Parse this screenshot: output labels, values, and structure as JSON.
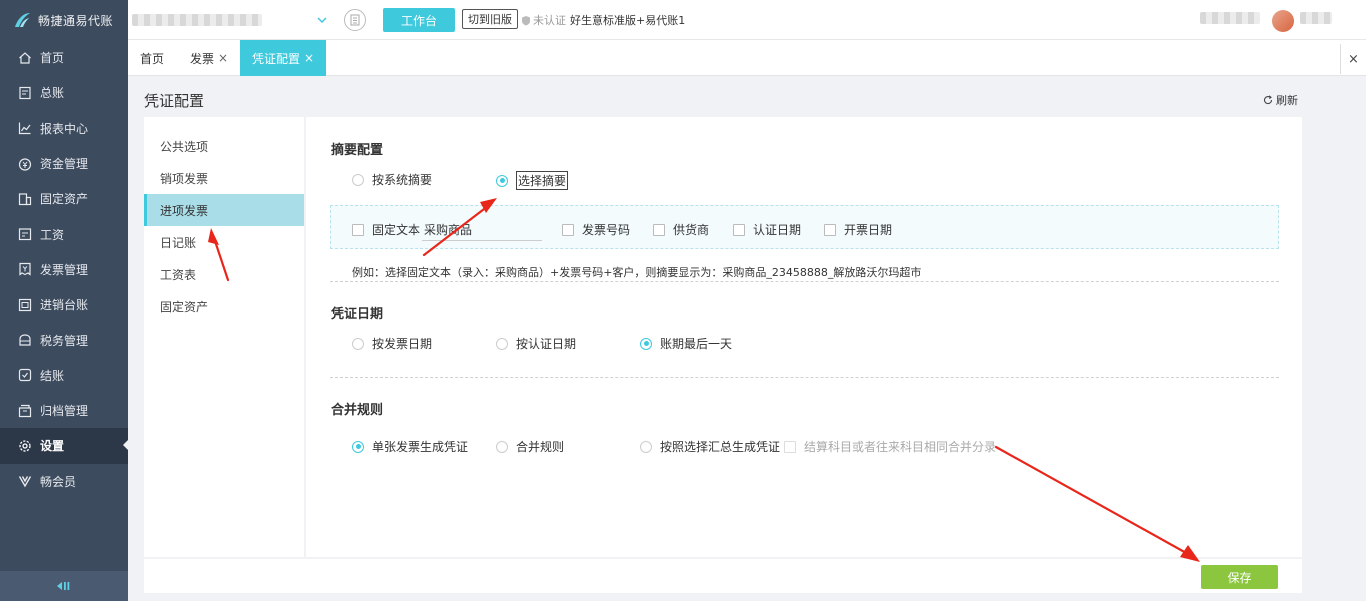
{
  "app": {
    "logo_text": "畅捷通易代账"
  },
  "topbar": {
    "workbench_label": "工作台",
    "old_version_label": "切到旧版",
    "cert_status": "未认证",
    "edition": "好生意标准版+易代账1"
  },
  "sidebar": {
    "items": [
      {
        "label": "首页",
        "icon": "home-icon"
      },
      {
        "label": "总账",
        "icon": "ledger-icon"
      },
      {
        "label": "报表中心",
        "icon": "chart-icon"
      },
      {
        "label": "资金管理",
        "icon": "money-icon"
      },
      {
        "label": "固定资产",
        "icon": "asset-icon"
      },
      {
        "label": "工资",
        "icon": "salary-icon"
      },
      {
        "label": "发票管理",
        "icon": "invoice-icon"
      },
      {
        "label": "进销台账",
        "icon": "account-book-icon"
      },
      {
        "label": "税务管理",
        "icon": "tax-icon"
      },
      {
        "label": "结账",
        "icon": "close-account-icon"
      },
      {
        "label": "归档管理",
        "icon": "archive-icon"
      },
      {
        "label": "设置",
        "icon": "gear-icon",
        "active": true
      },
      {
        "label": "畅会员",
        "icon": "vip-icon"
      }
    ]
  },
  "tabs": [
    {
      "label": "首页",
      "closable": false
    },
    {
      "label": "发票",
      "closable": true,
      "close": "×"
    },
    {
      "label": "凭证配置",
      "closable": true,
      "close": "×",
      "active": true
    }
  ],
  "tabs_close": "×",
  "page": {
    "title": "凭证配置",
    "refresh_label": "刷新"
  },
  "sub_menu": [
    {
      "label": "公共选项"
    },
    {
      "label": "销项发票"
    },
    {
      "label": "进项发票",
      "active": true
    },
    {
      "label": "日记账"
    },
    {
      "label": "工资表"
    },
    {
      "label": "固定资产"
    }
  ],
  "summary_config": {
    "title": "摘要配置",
    "options": [
      {
        "label": "按系统摘要",
        "selected": false
      },
      {
        "label": "选择摘要",
        "selected": true
      }
    ],
    "fields": {
      "fixed_text_label": "固定文本",
      "fixed_text_value": "采购商品",
      "invoice_no_label": "发票号码",
      "supplier_label": "供货商",
      "cert_date_label": "认证日期",
      "issue_date_label": "开票日期"
    },
    "example": "例如：选择固定文本（录入：采购商品）+发票号码+客户，则摘要显示为：采购商品_23458888_解放路沃尔玛超市"
  },
  "voucher_date": {
    "title": "凭证日期",
    "options": [
      {
        "label": "按发票日期",
        "selected": false
      },
      {
        "label": "按认证日期",
        "selected": false
      },
      {
        "label": "账期最后一天",
        "selected": true
      }
    ]
  },
  "merge_rules": {
    "title": "合并规则",
    "options": [
      {
        "label": "单张发票生成凭证",
        "selected": true
      },
      {
        "label": "合并规则",
        "selected": false
      },
      {
        "label": "按照选择汇总生成凭证",
        "selected": false
      }
    ],
    "merge_same_account_label": "结算科目或者往来科目相同合并分录"
  },
  "footer": {
    "save_label": "保存"
  },
  "colors": {
    "accent": "#3ec9dc",
    "sidebar_bg": "#3d4b5e",
    "save": "#8cc63f",
    "annotation_arrow": "#e8261a"
  }
}
